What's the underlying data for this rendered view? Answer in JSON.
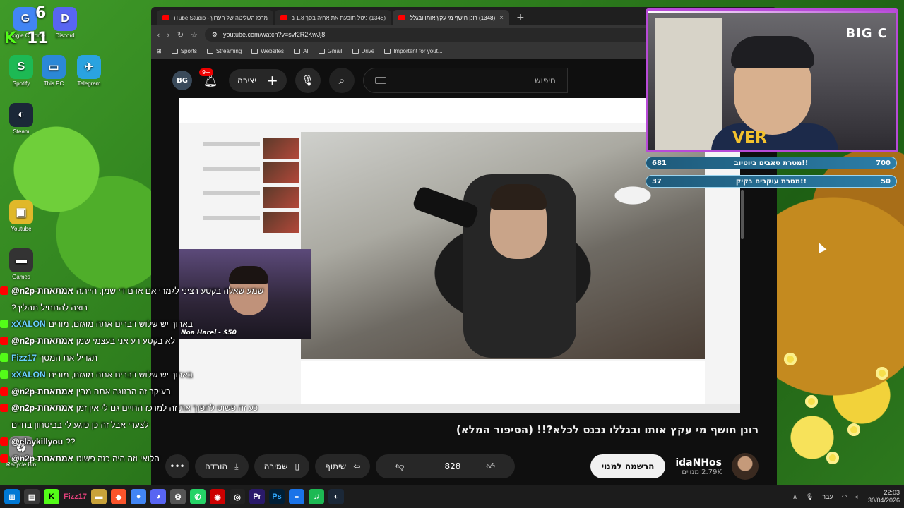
{
  "desktop": {
    "icons": [
      {
        "label": "Google Chrome",
        "glyph": "G",
        "color": "#4285f4",
        "badge": "6"
      },
      {
        "label": "Discord",
        "glyph": "D",
        "color": "#5865f2"
      },
      {
        "label": "Spotify",
        "glyph": "S",
        "color": "#1db954"
      },
      {
        "label": "This PC",
        "glyph": "▭",
        "color": "#2b88d8"
      },
      {
        "label": "Telegram",
        "glyph": "✈",
        "color": "#2aa3e0"
      },
      {
        "label": "Steam",
        "glyph": "◐",
        "color": "#1b2838"
      },
      {
        "label": "Youtube",
        "glyph": "▣",
        "color": "#e0b82a"
      },
      {
        "label": "Games",
        "glyph": "▬",
        "color": "#333"
      },
      {
        "label": "Recycle Bin",
        "glyph": "♻",
        "color": "#888"
      }
    ],
    "overlay_text": {
      "k_badge": "K",
      "count_11": "11",
      "count_6": "6"
    }
  },
  "browser": {
    "tabs": [
      {
        "title": "מרכז השליטה של הערוץ - YouTube Studio",
        "active": false
      },
      {
        "title": "(1348) ניטל תובעת את אחיה בסך 1.8 מיל",
        "active": false
      },
      {
        "title": "(1348) רונן חושף מי עקץ אותו ובגללו",
        "active": true
      }
    ],
    "url": "youtube.com/watch?v=svf2R2KwJj8",
    "bookmarks": [
      "Sports",
      "Streaming",
      "Websites",
      "AI",
      "Gmail",
      "Drive",
      "Importent for yout..."
    ]
  },
  "youtube": {
    "notif_badge": "9+",
    "create_label": "יצירה",
    "search_placeholder": "חיפוש",
    "avatar_text": "BG",
    "video": {
      "title": "רונן חושף מי עקץ אותו ובגללו נכנס לכלא?!! (הסיפור המלא)",
      "donation": "Noa Harel - $50"
    },
    "actions": {
      "likes": "828",
      "share": "שיתוף",
      "save": "שמירה",
      "download": "הורדה"
    },
    "channel": {
      "name": "idaNHos",
      "subscribers": "2.79K מנויים",
      "subscribe_label": "הרשמה למנוי"
    }
  },
  "stream_overlay": {
    "logo": "BIG C",
    "shirt_text": "VER",
    "goals": [
      {
        "label": "!!מטרת סאבים ביוטיוב",
        "current": "681",
        "target": "700"
      },
      {
        "label": "!!מטרת עוקבים בקיק",
        "current": "37",
        "target": "50"
      }
    ]
  },
  "chat": [
    {
      "platform": "youtube",
      "name": "@n2p-אמתאחת",
      "msg": "שמע שאלה בקטע רציני לגמרי אם אדם די שמן. הייתה"
    },
    {
      "platform": "none",
      "name": "",
      "msg": "רוצה להתחיל תהליך?"
    },
    {
      "platform": "kick",
      "name": "xXALON",
      "msg": "בארוך יש שלוש דברים אתה מוגזם, מורים"
    },
    {
      "platform": "youtube",
      "name": "@n2p-אמתאחת",
      "msg": "לא בקטע רע אני בעצמי שמן"
    },
    {
      "platform": "kick",
      "name": "Fizz17",
      "msg": "תגדיל את המסך"
    },
    {
      "platform": "kick",
      "name": "xXALON",
      "msg": "בארוך יש שלוש דברים אתה מוגזם, מורים"
    },
    {
      "platform": "youtube",
      "name": "@n2p-אמתאחת",
      "msg": "בעיקר זה הרזוגה אתה מבין"
    },
    {
      "platform": "youtube",
      "name": "@n2p-אמתאחת",
      "msg": "כע זה פשוט להפוך את זה למרכז החיים גם לי אין זמן"
    },
    {
      "platform": "none",
      "name": "",
      "msg": "לצערי אבל זה כן פוגע לי בביטחון בחיים"
    },
    {
      "platform": "youtube",
      "name": "@elaykillyou",
      "msg": "??"
    },
    {
      "platform": "youtube",
      "name": "@n2p-אמתאחת",
      "msg": "הלואי וזה היה כזה פשוט"
    }
  ],
  "taskbar": {
    "time": "22:03",
    "date": "30/04/2026",
    "lang": "עבר",
    "app_label": "Fizz17"
  },
  "colors": {
    "accent_red": "#ff0000",
    "goal_bar": "#2c7ea8",
    "webcam_border": "#b84ad8"
  }
}
